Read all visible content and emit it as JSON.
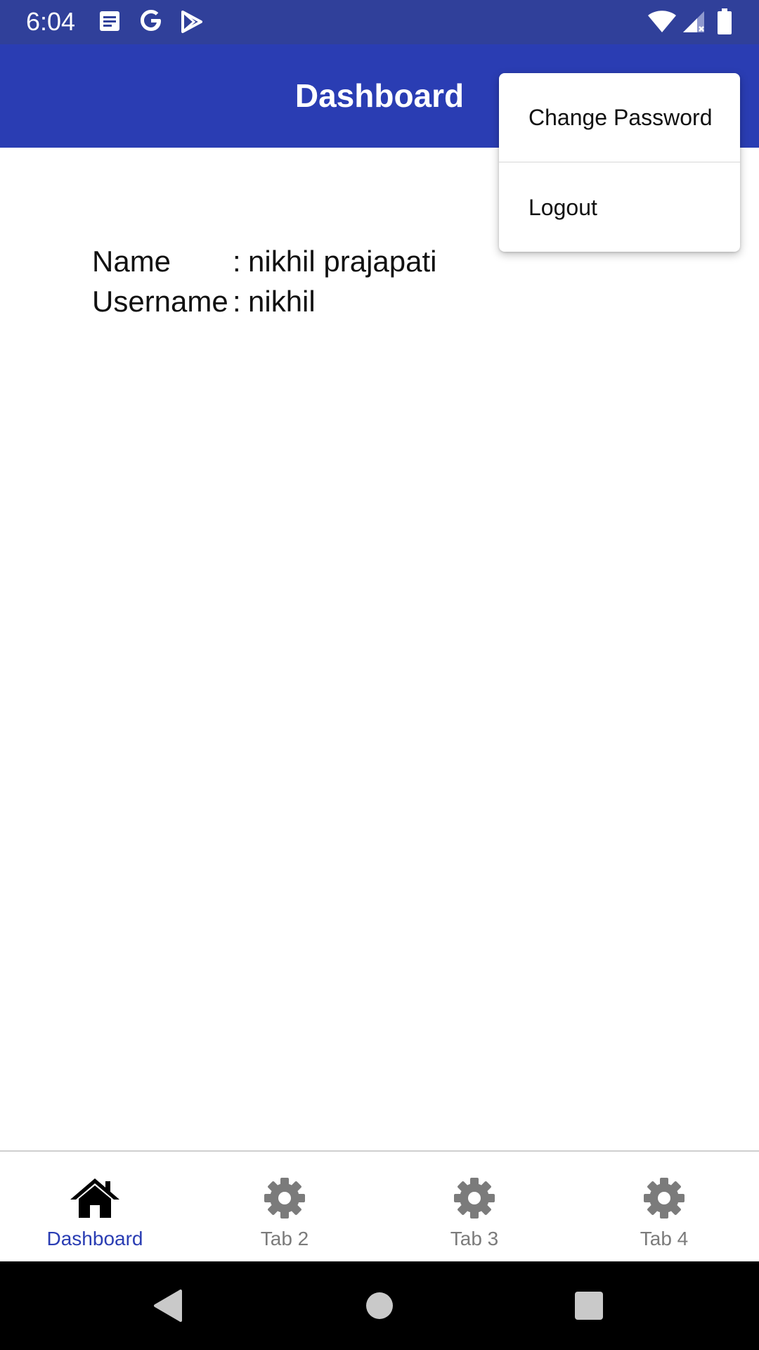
{
  "status_bar": {
    "time": "6:04",
    "icons": [
      "notes-icon",
      "google-icon",
      "play-store-icon",
      "wifi-icon",
      "signal-icon",
      "battery-icon"
    ]
  },
  "app_bar": {
    "title": "Dashboard"
  },
  "profile": {
    "name_label": "Name",
    "name_value": "nikhil prajapati",
    "username_label": "Username",
    "username_value": "nikhil",
    "separator": ":"
  },
  "menu": {
    "items": [
      {
        "label": "Change Password"
      },
      {
        "label": "Logout"
      }
    ]
  },
  "bottom_nav": {
    "tabs": [
      {
        "label": "Dashboard",
        "icon": "home-icon",
        "active": true
      },
      {
        "label": "Tab 2",
        "icon": "gear-icon",
        "active": false
      },
      {
        "label": "Tab 3",
        "icon": "gear-icon",
        "active": false
      },
      {
        "label": "Tab 4",
        "icon": "gear-icon",
        "active": false
      }
    ]
  },
  "system_nav": {
    "buttons": [
      "back",
      "home",
      "recents"
    ]
  },
  "colors": {
    "status_bar": "#30409a",
    "app_bar": "#2a3db3",
    "active_tab": "#2a3db3",
    "inactive_tab": "#7b7b7b"
  }
}
